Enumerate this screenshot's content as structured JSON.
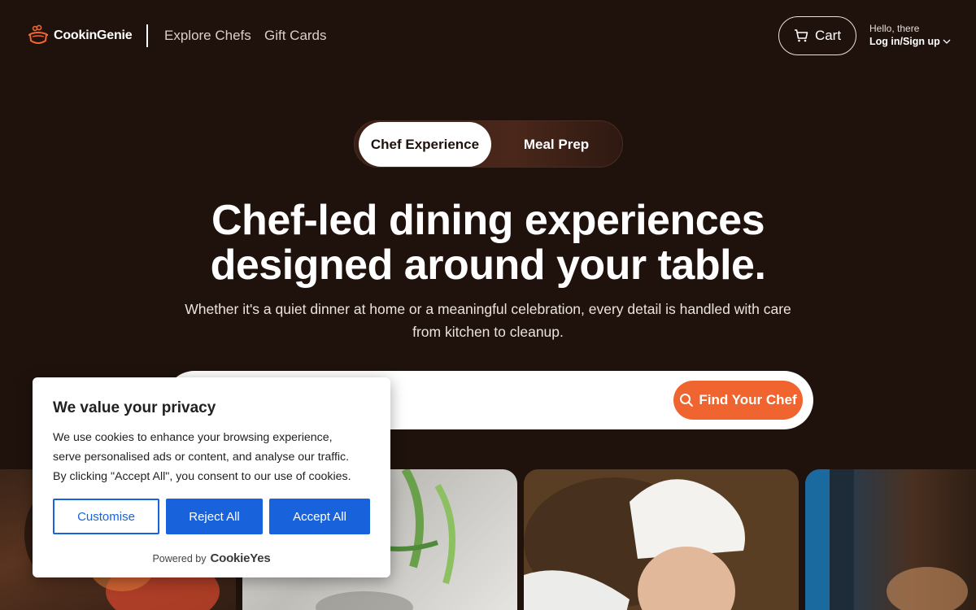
{
  "header": {
    "brand": "CookinGenie",
    "nav": [
      {
        "label": "Explore Chefs"
      },
      {
        "label": "Gift Cards"
      }
    ],
    "cart_label": "Cart",
    "greeting": "Hello, there",
    "login_label": "Log in/Sign up"
  },
  "toggle": {
    "tabs": [
      {
        "label": "Chef Experience",
        "active": true
      },
      {
        "label": "Meal Prep",
        "active": false
      }
    ]
  },
  "hero": {
    "title_line1": "Chef-led dining experiences",
    "title_line2": "designed around your table.",
    "subtitle_line1": "Whether it's a quiet dinner at home or a meaningful celebration, every detail is handled with care",
    "subtitle_line2": "from kitchen to cleanup."
  },
  "search": {
    "placeholder": "",
    "button_label": "Find Your Chef"
  },
  "cookie_banner": {
    "title": "We value your privacy",
    "text_line1": "We use cookies to enhance your browsing experience,",
    "text_line2": "serve personalised ads or content, and analyse our traffic.",
    "text_line3": "By clicking \"Accept All\", you consent to our use of cookies.",
    "customise_label": "Customise",
    "reject_label": "Reject All",
    "accept_label": "Accept All",
    "powered_by": "Powered by",
    "powered_brand": "CookieYes"
  },
  "colors": {
    "background": "#1f120d",
    "accent": "#f0652f",
    "cookie_button": "#1863dc"
  },
  "icons": [
    "logo-icon",
    "cart-icon",
    "chevron-down-icon",
    "search-icon"
  ]
}
